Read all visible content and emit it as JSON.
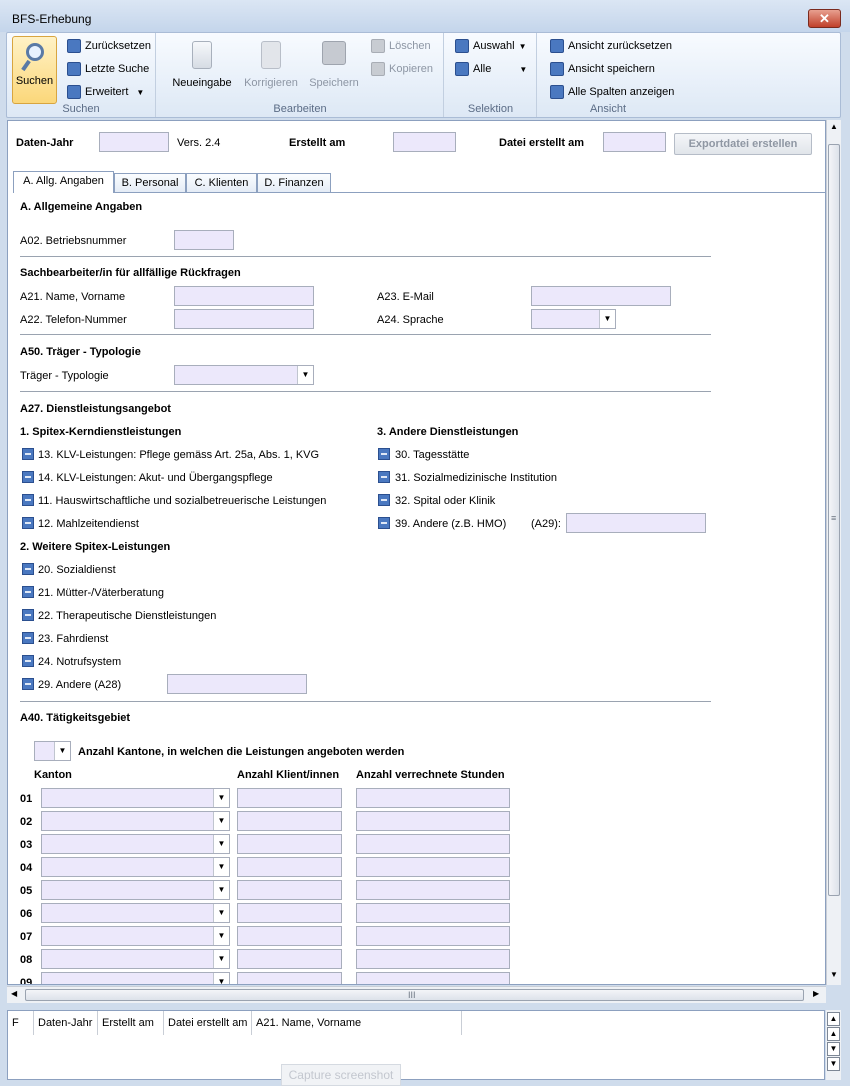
{
  "window": {
    "title": "BFS-Erhebung",
    "close_glyph": "✕"
  },
  "ribbon": {
    "suchen": {
      "label": "Suchen",
      "group_label": "Suchen",
      "items": [
        "Zurücksetzen",
        "Letzte Suche",
        "Erweitert"
      ]
    },
    "bearbeiten": {
      "group_label": "Bearbeiten",
      "neueingabe": "Neueingabe",
      "korrigieren": "Korrigieren",
      "speichern": "Speichern",
      "loeschen": "Löschen",
      "kopieren": "Kopieren"
    },
    "selektion": {
      "group_label": "Selektion",
      "auswahl": "Auswahl",
      "alle": "Alle"
    },
    "ansicht": {
      "group_label": "Ansicht",
      "reset": "Ansicht zurücksetzen",
      "save": "Ansicht speichern",
      "all_cols": "Alle Spalten anzeigen"
    }
  },
  "header": {
    "daten_jahr_label": "Daten-Jahr",
    "version": "Vers. 2.4",
    "erstellt_am_label": "Erstellt am",
    "datei_erstellt_label": "Datei erstellt am",
    "export_button": "Exportdatei erstellen"
  },
  "tabs": [
    "A. Allg. Angaben",
    "B. Personal",
    "C. Klienten",
    "D. Finanzen"
  ],
  "form": {
    "section_a": "A. Allgemeine Angaben",
    "a02": "A02. Betriebsnummer",
    "sachbearbeiter": "Sachbearbeiter/in für allfällige Rückfragen",
    "a21": "A21. Name, Vorname",
    "a22": "A22. Telefon-Nummer",
    "a23": "A23. E-Mail",
    "a24": "A24. Sprache",
    "a50": "A50. Träger - Typologie",
    "traeger": "Träger - Typologie",
    "a27": "A27. Dienstleistungsangebot",
    "kern_title": "1. Spitex-Kerndienstleistungen",
    "kern": [
      "13. KLV-Leistungen: Pflege gemäss Art. 25a, Abs. 1, KVG",
      "14. KLV-Leistungen: Akut- und Übergangspflege",
      "11. Hauswirtschaftliche und sozialbetreuerische Leistungen",
      "12. Mahlzeitendienst"
    ],
    "andere_title": "3. Andere Dienstleistungen",
    "andere": [
      "30. Tagesstätte",
      "31. Sozialmedizinische Institution",
      "32. Spital oder Klinik",
      "39. Andere (z.B. HMO)"
    ],
    "a29": "(A29):",
    "weitere_title": "2. Weitere Spitex-Leistungen",
    "weitere": [
      "20. Sozialdienst",
      "21. Mütter-/Väterberatung",
      "22. Therapeutische Dienstleistungen",
      "23. Fahrdienst",
      "24. Notrufsystem",
      "29. Andere (A28)"
    ],
    "a40": "A40. Tätigkeitsgebiet",
    "anzahl_kantone": "Anzahl Kantone, in welchen die Leistungen angeboten werden",
    "col_kanton": "Kanton",
    "col_klienten": "Anzahl Klient/innen",
    "col_stunden": "Anzahl verrechnete Stunden",
    "rows": [
      "01",
      "02",
      "03",
      "04",
      "05",
      "06",
      "07",
      "08",
      "09"
    ]
  },
  "grid": {
    "columns": [
      "F",
      "Daten-Jahr",
      "Erstellt am",
      "Datei erstellt am",
      "A21. Name, Vorname"
    ]
  },
  "hscroll_grip": "III",
  "vscroll_grip": "≡",
  "capture_button": "Capture screenshot"
}
